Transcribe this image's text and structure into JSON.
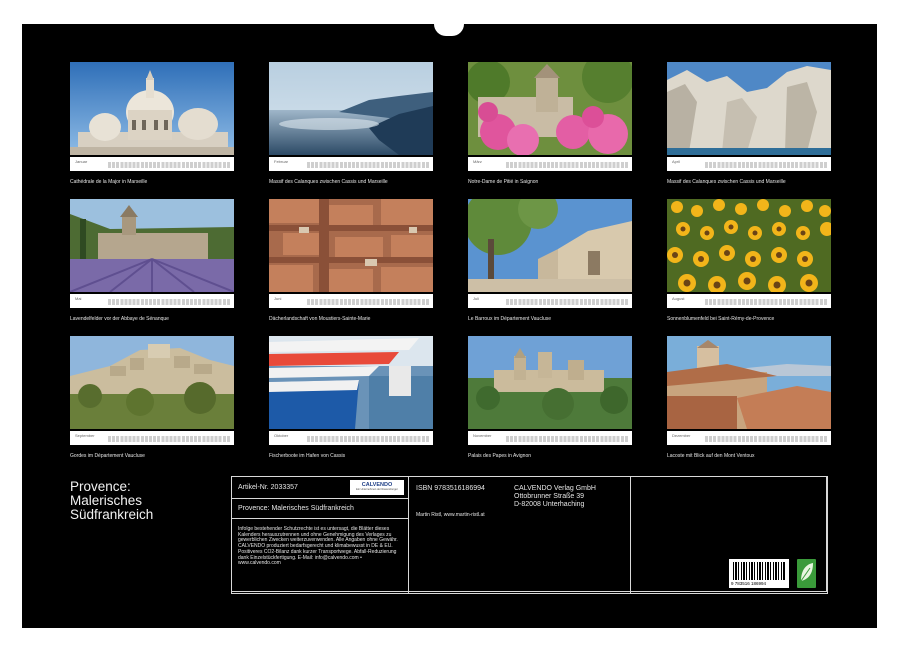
{
  "calendar_title": [
    "Provence:",
    "Malerisches",
    "Südfrankreich"
  ],
  "months": [
    {
      "month": "Januar",
      "caption": "Cathédrale de la Major in Marseille"
    },
    {
      "month": "Februar",
      "caption": "Massif des Calanques zwischen Cassis und Marseille"
    },
    {
      "month": "März",
      "caption": "Notre-Dame de Pitié in Saignon"
    },
    {
      "month": "April",
      "caption": "Massif des Calanques zwischen Cassis und Marseille"
    },
    {
      "month": "Mai",
      "caption": "Lavendelfelder vor der Abbaye de Sénanque"
    },
    {
      "month": "Juni",
      "caption": "Dächerlandschaft von Moustiers-Sainte-Marie"
    },
    {
      "month": "Juli",
      "caption": "Le Barroux im Département Vaucluse"
    },
    {
      "month": "August",
      "caption": "Sonnenblumenfeld bei Saint-Rémy-de-Provence"
    },
    {
      "month": "September",
      "caption": "Gordes im Département Vaucluse"
    },
    {
      "month": "Oktober",
      "caption": "Fischerboote im Hafen von Cassis"
    },
    {
      "month": "November",
      "caption": "Palais des Papes in Avignon"
    },
    {
      "month": "Dezember",
      "caption": "Lacoste mit Blick auf den Mont Ventoux"
    }
  ],
  "info": {
    "article": "Artikel-Nr. 2033357",
    "logo": "CALVENDO",
    "logo_sub": "Ein Unternehmen der Ravensburger",
    "product_title": "Provence: Malerisches Südfrankreich",
    "legal_text": "Infolge bestehender Schutzrechte ist es untersagt, die Blätter dieses Kalenders herauszutrennen und ohne Genehmigung des Verlages zu gewerblichen Zwecken weiterzuverwenden. Alle Angaben ohne Gewähr. CALVENDO produziert bedarfsgerecht und klimabewusst in DE & EU. Positiveres CO2-Bilanz dank kurzer Transportwege. Abfall-Reduzierung dank Einzelstückfertigung. E-Mail: info@calvendo.com • www.calvendo.com",
    "isbn": "ISBN 9783516186994",
    "author": "Martin Ristl, www.martin-ristl.at",
    "publisher": [
      "CALVENDO Verlag GmbH",
      "Ottobrunner Straße 39",
      "D-82008 Unterhaching"
    ],
    "barcode_text": "9 783516 186994"
  },
  "colors": {
    "background": "#000000",
    "text": "#e6e6e6",
    "frame": "#d9d9d9"
  }
}
